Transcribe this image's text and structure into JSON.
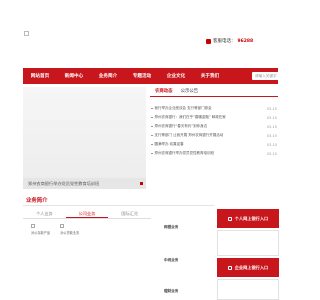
{
  "header": {
    "hotline_label": "客服电话：",
    "hotline_number": "96288"
  },
  "nav": {
    "items": [
      "网站首页",
      "新闻中心",
      "业务简介",
      "专题活动",
      "企业文化",
      "关于我们"
    ],
    "search_placeholder": "请输入关键字"
  },
  "banner": {
    "caption": "郑州农商银行举办党员党性教育培训班"
  },
  "news": {
    "tabs": [
      "农商动态",
      "公示公告"
    ],
    "items": [
      {
        "title": "我行举办企业座谈会 支行等部门参会",
        "date": "03-15"
      },
      {
        "title": "郑州农商银行：我们在乎“春暖金融” 邮政在家",
        "date": "03-15"
      },
      {
        "title": "郑州农商银行“春天有约”到你身边",
        "date": "03-15"
      },
      {
        "title": "支行等部门 让我开展 郑州农商银行开展活动",
        "date": "03-15"
      },
      {
        "title": "圆满举办 欢喜迎春",
        "date": "03-15"
      },
      {
        "title": "郑州农商银行举办党员党性教育培训班",
        "date": "03-15"
      }
    ]
  },
  "business": {
    "title": "业务简介",
    "tabs": [
      "个人业务",
      "公司业务",
      "国际汇兑"
    ],
    "icons": [
      "对公存款产品",
      "对公贷款业务"
    ],
    "side_labels": [
      "网银业务",
      "中间业务",
      "理财业务"
    ]
  },
  "right": {
    "personal_bank": "个人网上银行入口",
    "corporate_bank": "企业网上银行入口"
  }
}
